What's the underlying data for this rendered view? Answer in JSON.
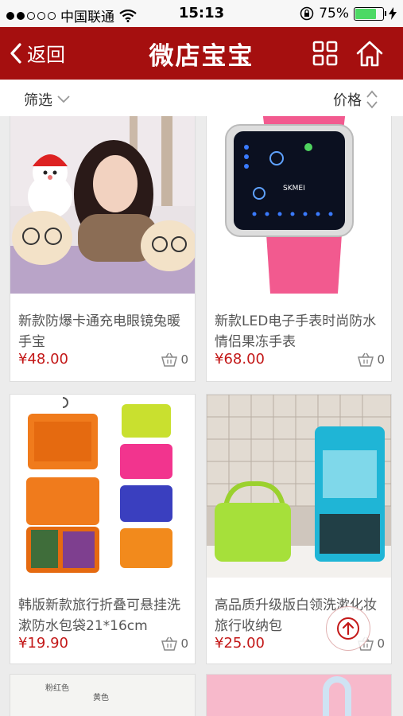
{
  "status_bar": {
    "carrier": "中国联通",
    "time": "15:13",
    "battery": "75%",
    "battery_level": 0.75
  },
  "header": {
    "back_label": "返回",
    "title": "微店宝宝",
    "grid_icon": "grid-icon",
    "home_icon": "home-icon",
    "color": "#a50f0f"
  },
  "filter": {
    "filter_label": "筛选",
    "price_label": "价格"
  },
  "products": [
    {
      "name": "新款防爆卡通充电眼镜兔暖手宝",
      "price": "¥48.00",
      "cart_count": "0"
    },
    {
      "name": "新款LED电子手表时尚防水情侣果冻手表",
      "price": "¥68.00",
      "cart_count": "0"
    },
    {
      "name": "韩版新款旅行折叠可悬挂洗漱防水包袋21*16cm",
      "price": "¥19.90",
      "cart_count": "0"
    },
    {
      "name": "高品质升级版白领洗漱化妆旅行收纳包",
      "price": "¥25.00",
      "cart_count": "0"
    }
  ],
  "partial_image_text": {
    "a": "粉红色",
    "b": "黄色"
  },
  "accent_price_color": "#c31818"
}
